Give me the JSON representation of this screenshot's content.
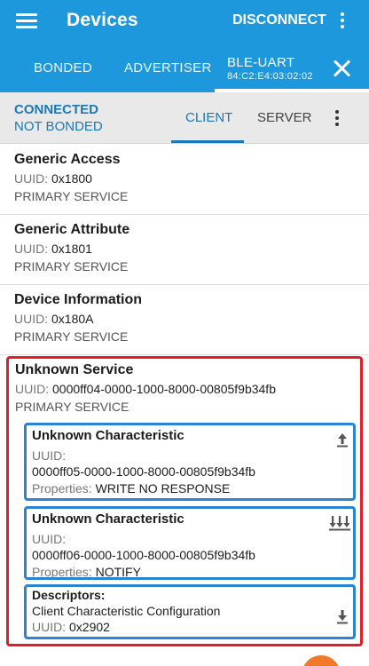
{
  "app_bar": {
    "title": "Devices",
    "disconnect_label": "DISCONNECT"
  },
  "tabs": {
    "bonded": "BONDED",
    "advertiser": "ADVERTISER",
    "device_name": "BLE-UART",
    "device_mac": "84:C2:E4:03:02:02"
  },
  "status": {
    "connection": "CONNECTED",
    "bond": "NOT BONDED",
    "client_tab": "CLIENT",
    "server_tab": "SERVER"
  },
  "services": [
    {
      "name": "Generic Access",
      "uuid_label": "UUID:",
      "uuid": "0x1800",
      "type": "PRIMARY SERVICE"
    },
    {
      "name": "Generic Attribute",
      "uuid_label": "UUID:",
      "uuid": "0x1801",
      "type": "PRIMARY SERVICE"
    },
    {
      "name": "Device Information",
      "uuid_label": "UUID:",
      "uuid": "0x180A",
      "type": "PRIMARY SERVICE"
    }
  ],
  "unknown_service": {
    "name": "Unknown Service",
    "uuid_label": "UUID:",
    "uuid": "0000ff04-0000-1000-8000-00805f9b34fb",
    "type": "PRIMARY SERVICE",
    "characteristics": [
      {
        "name": "Unknown Characteristic",
        "uuid_label": "UUID:",
        "uuid": "0000ff05-0000-1000-8000-00805f9b34fb",
        "properties_label": "Properties:",
        "properties": "WRITE NO RESPONSE",
        "icon": "upload-arrow-icon"
      },
      {
        "name": "Unknown Characteristic",
        "uuid_label": "UUID:",
        "uuid": "0000ff06-0000-1000-8000-00805f9b34fb",
        "properties_label": "Properties:",
        "properties": "NOTIFY",
        "icon": "multi-download-icon"
      }
    ],
    "descriptor": {
      "title": "Descriptors:",
      "name": "Client Characteristic Configuration",
      "uuid_label": "UUID:",
      "uuid": "0x2902",
      "icon": "download-arrow-icon"
    }
  },
  "colors": {
    "app_bar": "#1e98dc",
    "accent": "#1a78b8",
    "highlight_red": "#e01e25",
    "highlight_blue": "#2b83d3"
  }
}
